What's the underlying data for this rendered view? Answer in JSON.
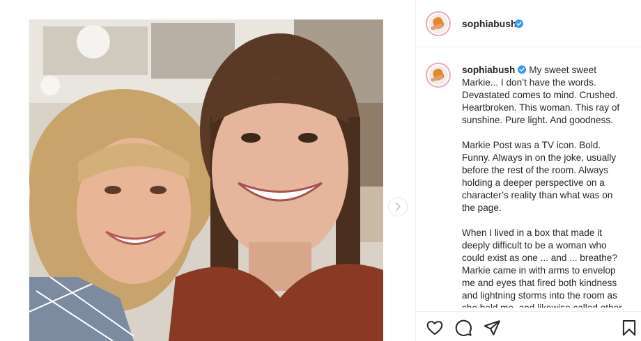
{
  "post": {
    "username": "sophiabush",
    "verified": true,
    "caption_paragraphs": [
      "My sweet sweet Markie... I don’t have the words. Devastated comes to mind. Crushed. Heartbroken. This woman. This ray of sunshine. Pure light. And goodness.",
      "Markie Post was a TV icon. Bold. Funny. Always in on the joke, usually before the rest of the room. Always holding a deeper perspective on a character’s reality than what was on the page.",
      "When I lived in a box that made it deeply difficult to be a woman who could exist as one ... and ... breathe? Markie came in with arms to envelop me and eyes that fired both kindness and lightning storms into the room as she held me, and likewise called other"
    ]
  },
  "icons": {
    "next": "chevron-right-icon",
    "like": "heart-icon",
    "comment": "comment-icon",
    "share": "paper-plane-icon",
    "save": "bookmark-icon",
    "verified": "verified-badge-icon"
  },
  "colors": {
    "verified_blue": "#3897f0",
    "avatar_ring": "#e8a9b6",
    "border": "#efefef"
  }
}
